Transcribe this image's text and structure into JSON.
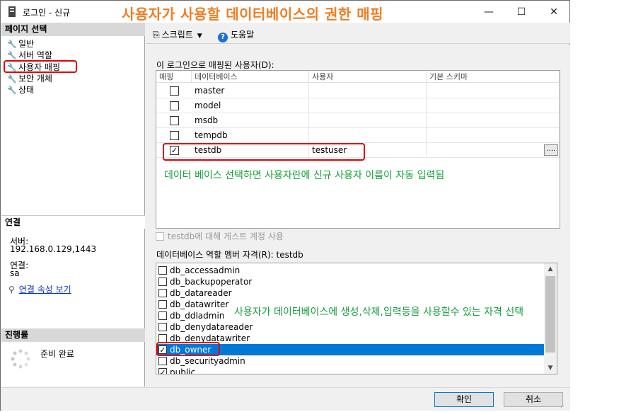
{
  "window": {
    "title": "로그인 - 신규",
    "minimize": "—",
    "maximize": "☐",
    "close": "✕"
  },
  "overlay_title": "사용자가 사용할 데이터베이스의 권한 매핑",
  "sidebar": {
    "page_select_header": "페이지 선택",
    "items": [
      {
        "label": "일반"
      },
      {
        "label": "서버 역할"
      },
      {
        "label": "사용자 매핑"
      },
      {
        "label": "보안 개체"
      },
      {
        "label": "상태"
      }
    ],
    "connection_header": "연결",
    "server_label": "서버:",
    "server_value": "192.168.0.129,1443",
    "conn_label": "연결:",
    "conn_value": "sa",
    "conn_props_link": "연결 속성 보기",
    "progress_header": "진행률",
    "progress_status": "준비 완료"
  },
  "toolbar": {
    "script_label": "스크립트",
    "help_label": "도움말"
  },
  "mapping": {
    "section_label": "이 로그인으로 매핑된 사용자(D):",
    "columns": [
      "매핑",
      "데이터베이스",
      "사용자",
      "기본 스키마"
    ],
    "rows": [
      {
        "checked": false,
        "mark": "",
        "database": "master",
        "user": "",
        "schema": ""
      },
      {
        "checked": false,
        "mark": "",
        "database": "model",
        "user": "",
        "schema": ""
      },
      {
        "checked": false,
        "mark": "",
        "database": "msdb",
        "user": "",
        "schema": ""
      },
      {
        "checked": false,
        "mark": "",
        "database": "tempdb",
        "user": "",
        "schema": ""
      },
      {
        "checked": true,
        "mark": "✓",
        "database": "testdb",
        "user": "testuser",
        "schema": ""
      }
    ],
    "ellipsis": "....",
    "annotation": "데이터 베이스 선택하면 사용자란에 신규 사용자 이름이 자동 입력됨"
  },
  "guest_account": {
    "label": "testdb에 대해 게스트 계정 사용",
    "enabled": false
  },
  "roles": {
    "section_label": "데이터베이스 역할 멤버 자격(R): testdb",
    "items": [
      {
        "name": "db_accessadmin",
        "checked": false,
        "mark": ""
      },
      {
        "name": "db_backupoperator",
        "checked": false,
        "mark": ""
      },
      {
        "name": "db_datareader",
        "checked": false,
        "mark": ""
      },
      {
        "name": "db_datawriter",
        "checked": false,
        "mark": ""
      },
      {
        "name": "db_ddladmin",
        "checked": false,
        "mark": ""
      },
      {
        "name": "db_denydatareader",
        "checked": false,
        "mark": ""
      },
      {
        "name": "db_denydatawriter",
        "checked": false,
        "mark": ""
      },
      {
        "name": "db_owner",
        "checked": true,
        "mark": "✓",
        "selected": true
      },
      {
        "name": "db_securityadmin",
        "checked": false,
        "mark": ""
      },
      {
        "name": "public",
        "checked": true,
        "mark": "✓"
      }
    ],
    "annotation": "사용자가 데이터베이스에 생성,삭제,입력등을 사용할수 있는 자격 선택"
  },
  "buttons": {
    "ok": "확인",
    "cancel": "취소"
  },
  "colors": {
    "overlay_title": "#f07d22",
    "annotation": "#18a03c",
    "highlight_box": "#e00000",
    "selection": "#0078d7"
  }
}
